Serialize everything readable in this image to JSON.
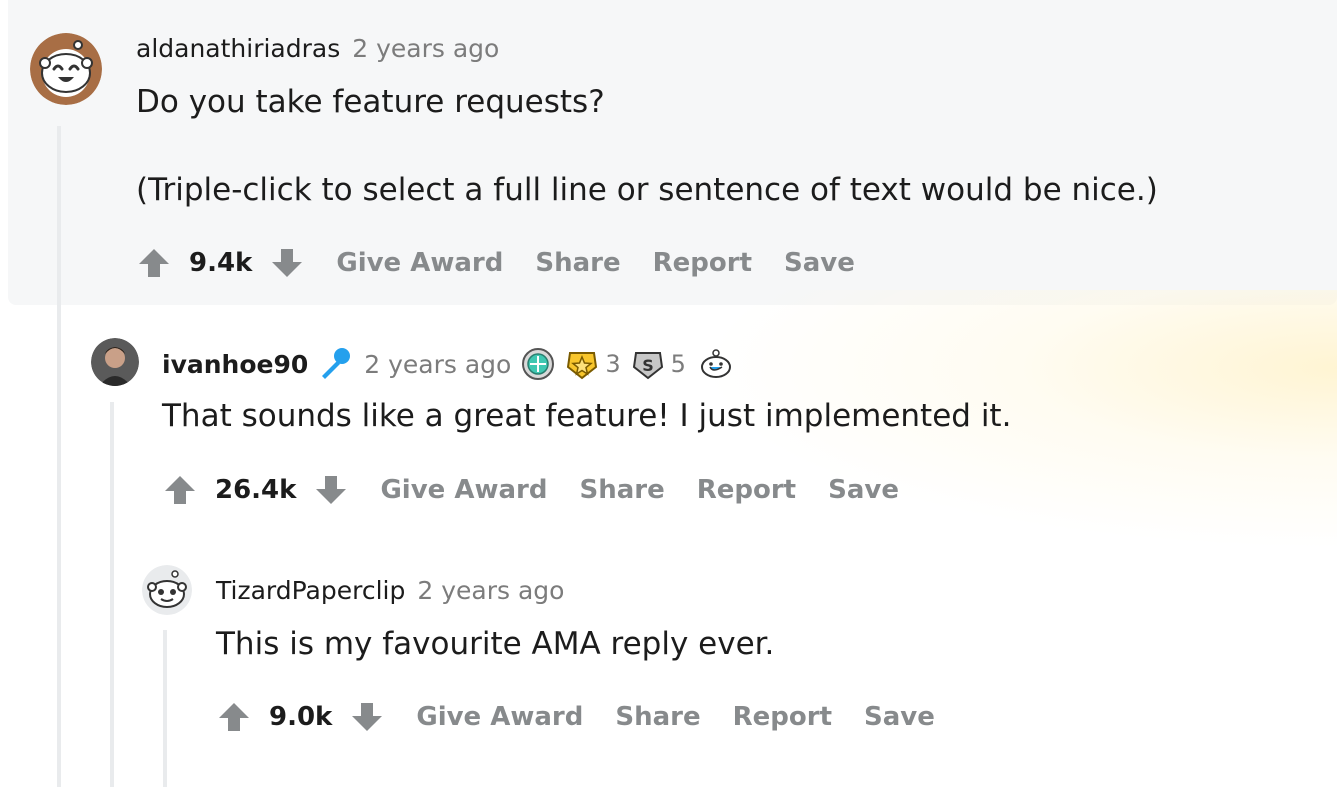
{
  "comments": [
    {
      "username": "aldanathiriadras",
      "time": "2 years ago",
      "body": [
        "Do you take feature requests?",
        "(Triple-click to select a full line or sentence of text would be nice.)"
      ],
      "score": "9.4k",
      "actions": [
        "Give Award",
        "Share",
        "Report",
        "Save"
      ],
      "avatar": "snoo-avatar-brown"
    },
    {
      "username": "ivanhoe90",
      "time": "2 years ago",
      "body": [
        "That sounds like a great feature! I just implemented it."
      ],
      "score": "26.4k",
      "actions": [
        "Give Award",
        "Share",
        "Report",
        "Save"
      ],
      "avatar": "user-photo-avatar",
      "awards": [
        {
          "icon": "green-award-icon",
          "count": ""
        },
        {
          "icon": "gold-star-award-icon",
          "count": "3"
        },
        {
          "icon": "silver-award-icon",
          "count": "5"
        },
        {
          "icon": "wholesome-award-icon",
          "count": ""
        }
      ],
      "flair_icon": "microphone-icon"
    },
    {
      "username": "TizardPaperclip",
      "time": "2 years ago",
      "body": [
        "This is my favourite AMA reply ever."
      ],
      "score": "9.0k",
      "actions": [
        "Give Award",
        "Share",
        "Report",
        "Save"
      ],
      "avatar": "snoo-avatar-white"
    }
  ],
  "colors": {
    "highlight_bg": "#f6f7f8",
    "action_gray": "#878a8c",
    "text": "#1c1c1c",
    "meta_gray": "#7c7c7c",
    "mic_blue": "#24a0ed"
  }
}
